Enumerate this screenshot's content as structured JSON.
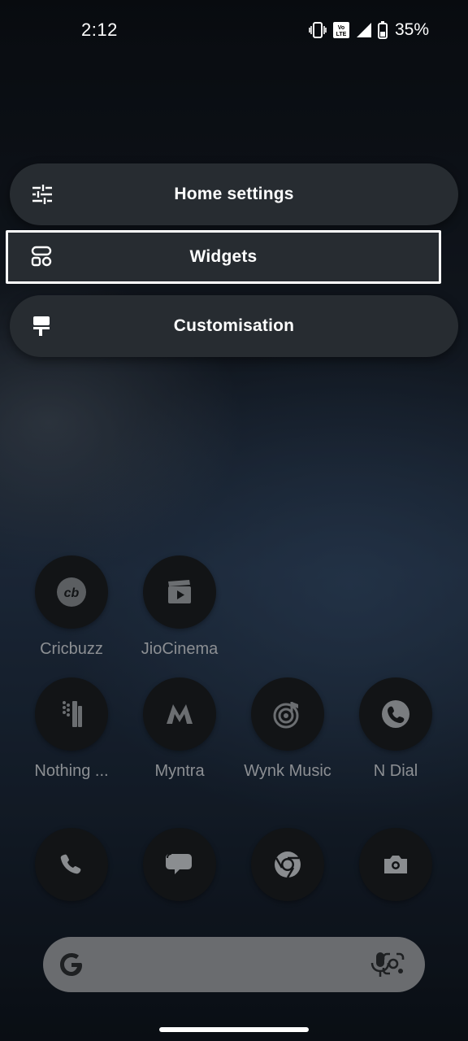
{
  "status_bar": {
    "time": "2:12",
    "network_badge": "Vo LTE",
    "battery_percent": "35%"
  },
  "menu": {
    "items": [
      {
        "label": "Home settings",
        "icon": "sliders-icon"
      },
      {
        "label": "Widgets",
        "icon": "widgets-icon"
      },
      {
        "label": "Customisation",
        "icon": "paint-roller-icon"
      }
    ]
  },
  "apps": {
    "row1": [
      {
        "label": "Cricbuzz",
        "icon": "cricbuzz-icon"
      },
      {
        "label": "JioCinema",
        "icon": "jiocinema-icon"
      }
    ],
    "row2": [
      {
        "label": "Nothing ...",
        "icon": "nothing-icon"
      },
      {
        "label": "Myntra",
        "icon": "myntra-icon"
      },
      {
        "label": "Wynk Music",
        "icon": "wynk-music-icon"
      },
      {
        "label": "N Dial",
        "icon": "n-dial-icon"
      }
    ],
    "dock": [
      {
        "icon": "phone-icon"
      },
      {
        "icon": "messages-icon"
      },
      {
        "icon": "chrome-icon"
      },
      {
        "icon": "camera-icon"
      }
    ]
  },
  "search": {
    "icons": [
      "google-icon",
      "microphone-icon",
      "lens-icon"
    ]
  },
  "colors": {
    "menu_pill": "#272c31",
    "app_circle": "#121416",
    "search_bar": "#6a6c6f",
    "label_text": "#8c8f93"
  }
}
